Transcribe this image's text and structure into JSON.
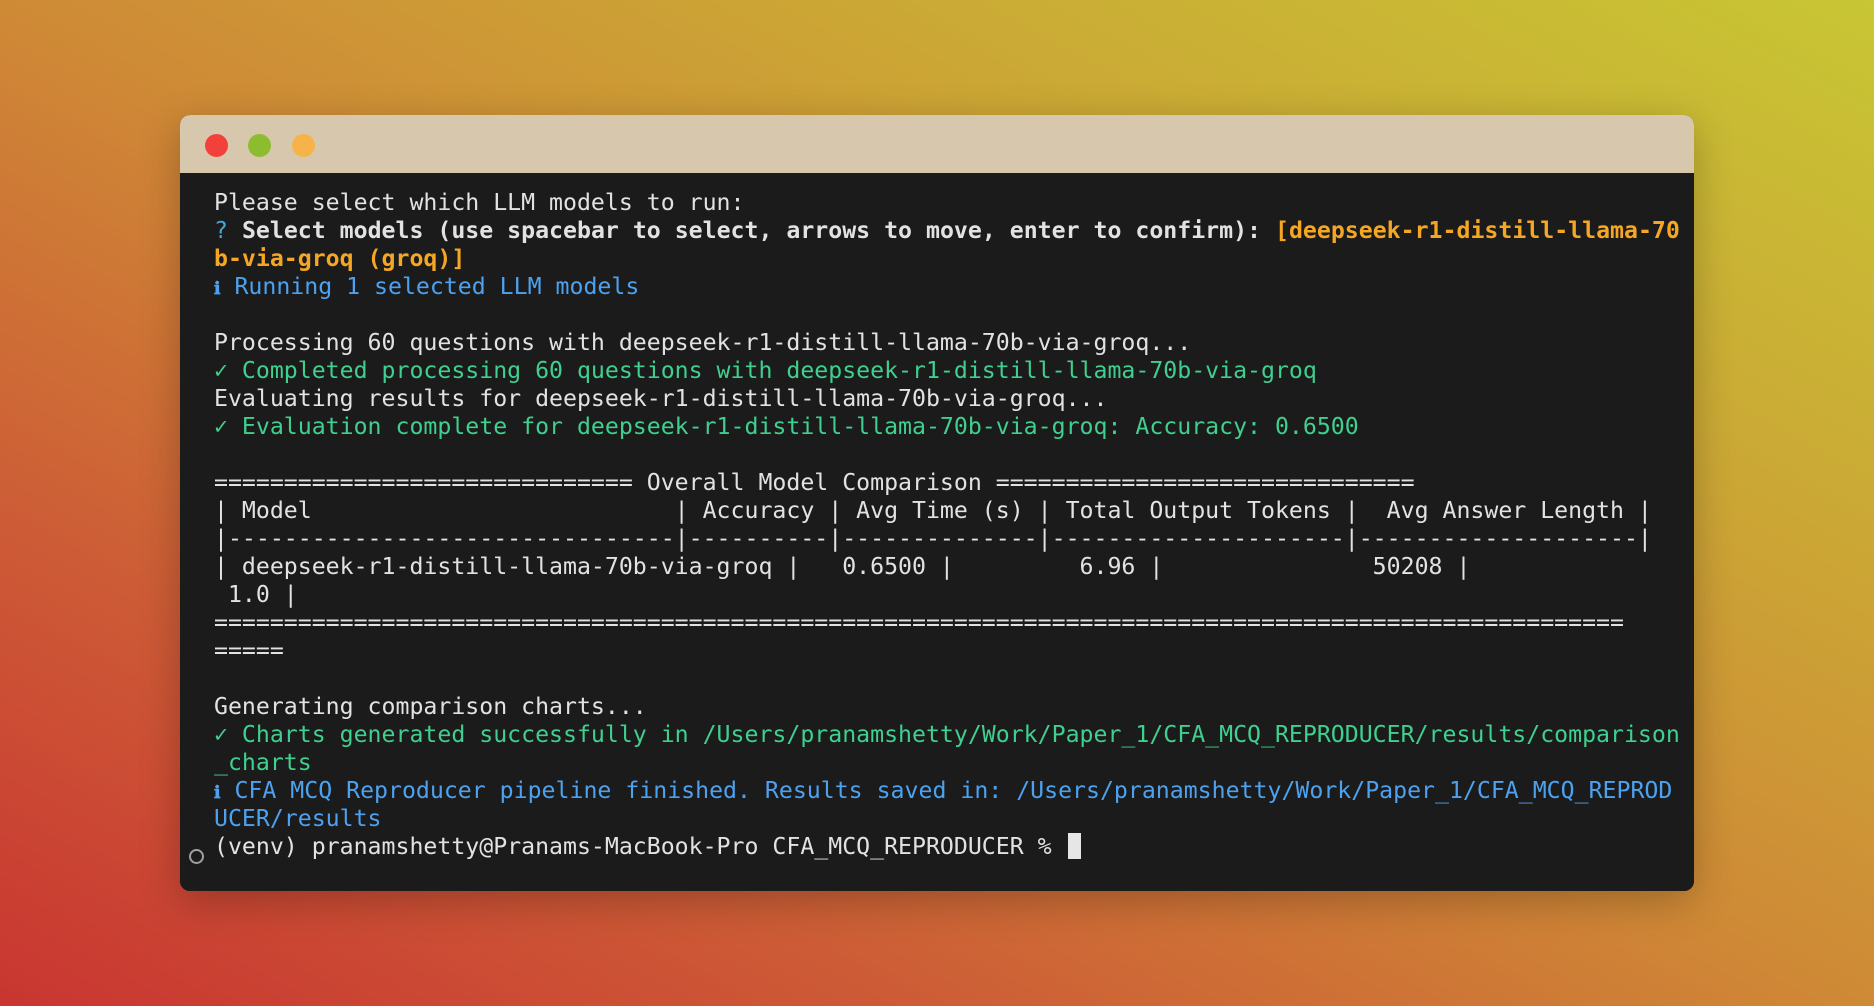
{
  "window": {
    "traffic_lights": [
      "close",
      "minimize",
      "zoom"
    ]
  },
  "terminal": {
    "select_prompt": "Please select which LLM models to run:",
    "question_mark": "?",
    "select_question": "Select models (use spacebar to select, arrows to move, enter to confirm):",
    "select_answer_a": "[deepseek-r1-distill-llama-70",
    "select_answer_b": "b-via-groq (groq)]",
    "info_glyph": "ℹ",
    "running_msg": "Running 1 selected LLM models",
    "processing_msg": "Processing 60 questions with deepseek-r1-distill-llama-70b-via-groq...",
    "completed_msg": "✓ Completed processing 60 questions with deepseek-r1-distill-llama-70b-via-groq",
    "evaluating_msg": "Evaluating results for deepseek-r1-distill-llama-70b-via-groq...",
    "evaluation_msg": "✓ Evaluation complete for deepseek-r1-distill-llama-70b-via-groq: Accuracy: 0.6500",
    "table_banner": "============================== Overall Model Comparison ==============================",
    "table_header": "| Model                          | Accuracy | Avg Time (s) | Total Output Tokens |  Avg Answer Length |",
    "table_separator": "|--------------------------------|----------|--------------|---------------------|--------------------|",
    "table_row_a": "| deepseek-r1-distill-llama-70b-via-groq |   0.6500 |         6.96 |               50208 |",
    "table_row_b": " 1.0 |",
    "table_footer_a": "=====================================================================================================",
    "table_footer_b": "=====",
    "generating_msg": "Generating comparison charts...",
    "charts_msg_a": "✓ Charts generated successfully in /Users/pranamshetty/Work/Paper_1/CFA_MCQ_REPRODUCER/results/comparison",
    "charts_msg_b": "_charts",
    "finished_msg_a": "CFA MCQ Reproducer pipeline finished. Results saved in: /Users/pranamshetty/Work/Paper_1/CFA_MCQ_REPROD",
    "finished_msg_b": "UCER/results",
    "shell_prompt": "(venv) pranamshetty@Pranams-MacBook-Pro CFA_MCQ_REPRODUCER %"
  },
  "colors": {
    "background_text": "#e2e2e2",
    "success": "#3fcf8e",
    "info": "#4ca2f0",
    "answer": "#f5a623"
  }
}
